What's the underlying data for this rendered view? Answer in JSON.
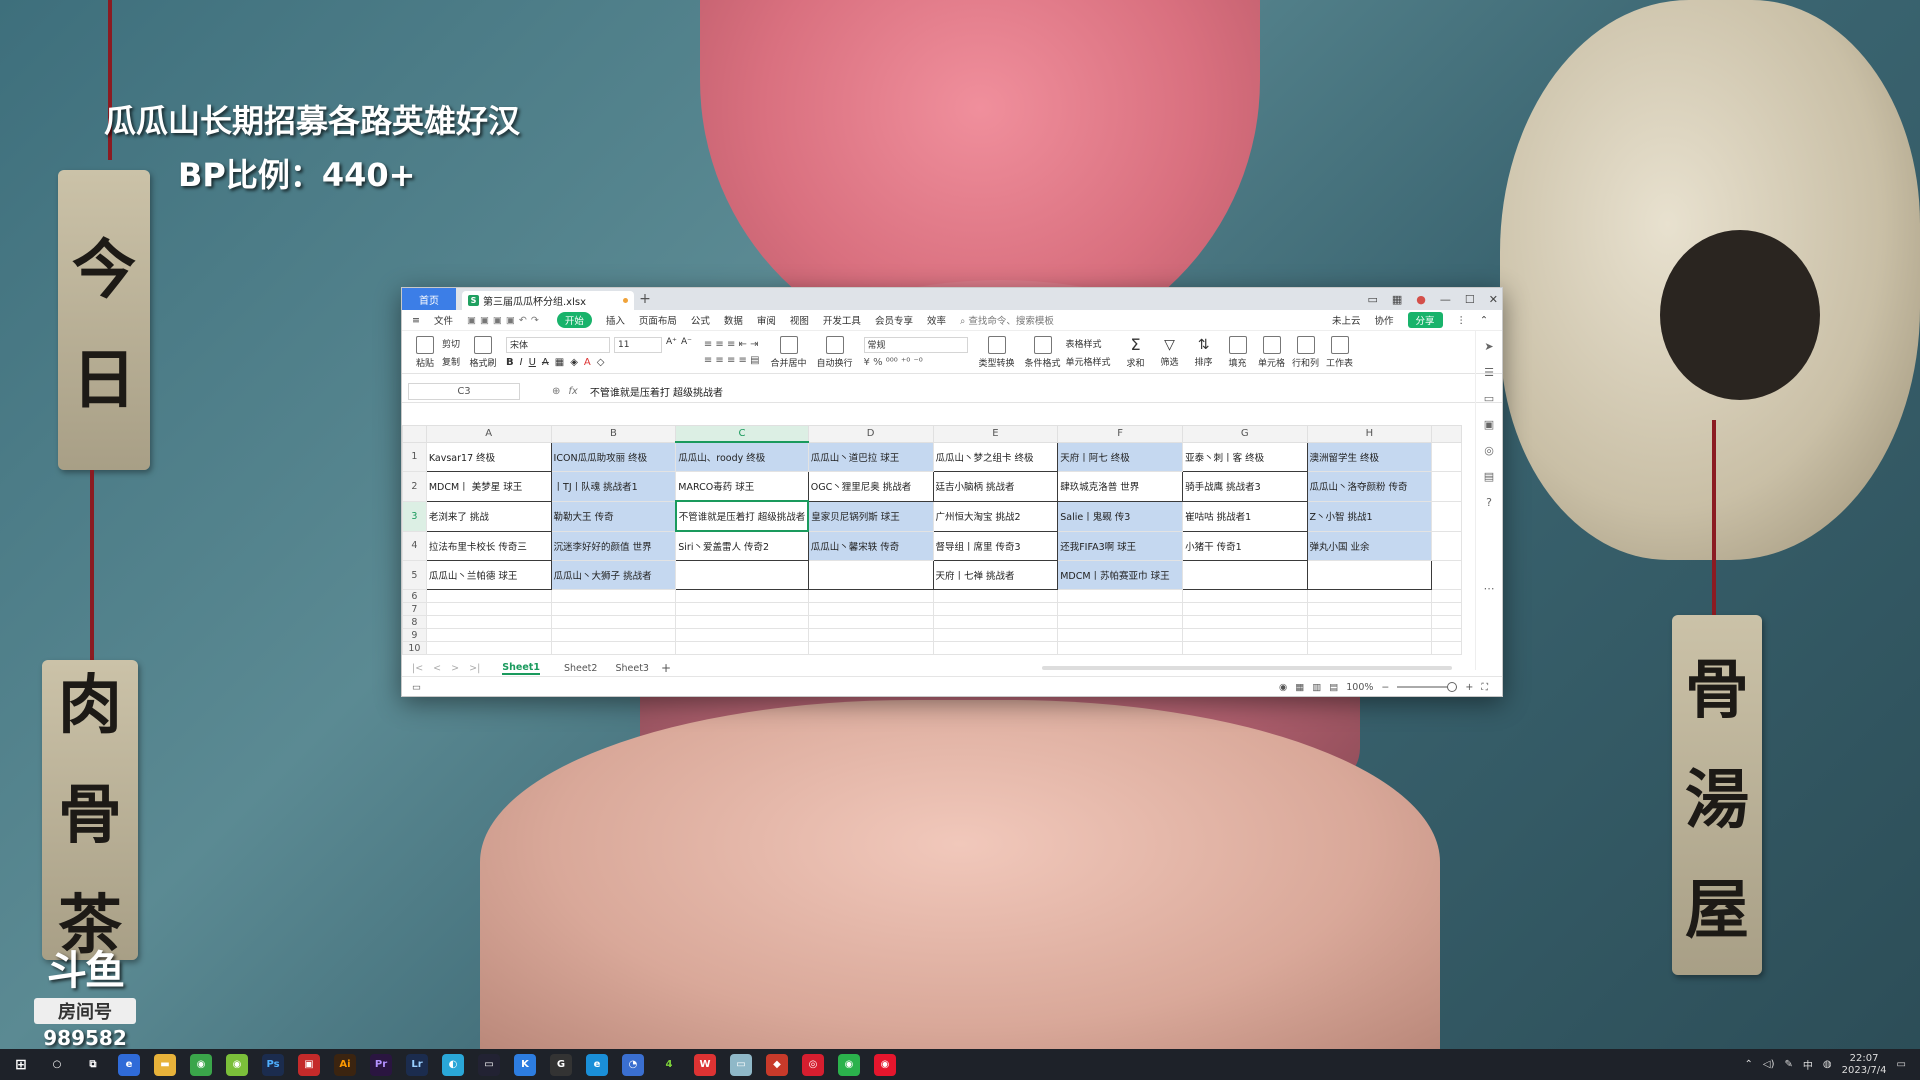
{
  "overlay": {
    "line1": "瓜瓜山长期招募各路英雄好汉",
    "line2": "BP比例：440+",
    "room_label": "房间号",
    "room_number": "989582",
    "brand": "斗鱼"
  },
  "wallpaper_tags": {
    "left_top": [
      "今",
      "日"
    ],
    "left_bottom": [
      "肉",
      "骨",
      "茶"
    ],
    "right": [
      "骨",
      "湯",
      "屋"
    ]
  },
  "app": {
    "home_tab": "首页",
    "file_tab": "第三届瓜瓜杯分组.xlsx",
    "menu": [
      "文件",
      "开始",
      "插入",
      "页面布局",
      "公式",
      "数据",
      "审阅",
      "视图",
      "开发工具",
      "会员专享",
      "效率"
    ],
    "active_menu": "开始",
    "search_placeholder": "查找命令、搜索模板",
    "cloud_label": "未上云",
    "collab_label": "协作",
    "share_label": "分享",
    "ribbon": {
      "paste": "粘贴",
      "cut": "剪切",
      "copy": "复制",
      "format_painter": "格式刷",
      "font_name": "宋体",
      "font_size": "11",
      "merge": "合并居中",
      "wrap": "自动换行",
      "number_format": "常规",
      "type_convert": "类型转换",
      "cond_format": "条件格式",
      "table_style": "表格样式",
      "cell_style": "单元格样式",
      "sum": "求和",
      "filter": "筛选",
      "sort": "排序",
      "fill": "填充",
      "cell": "单元格",
      "rowcol": "行和列",
      "worksheet": "工作表"
    },
    "namebox": "C3",
    "formula": "不管谁就是压着打 超级挑战者",
    "columns": [
      "A",
      "B",
      "C",
      "D",
      "E",
      "F",
      "G",
      "H"
    ],
    "selected_col": "C",
    "rows": [
      [
        "Kavsar17  终极",
        "ICON瓜瓜助攻丽  终极",
        "瓜瓜山、roody  终极",
        "瓜瓜山丶道巴拉  球王",
        "瓜瓜山丶梦之组卡 终极",
        "天府丨阿七  终极",
        "亚泰丶刺丨客  终极",
        "澳洲留学生 终极"
      ],
      [
        "MDCM丨 美梦星 球王",
        "丨TJ丨队魂 挑战者1",
        "MARCO毒药  球王",
        "OGC丶狸里尼奥 挑战者",
        "廷吉小脑柄 挑战者",
        "肆玖城克洛普 世界",
        "骑手战鹰 挑战者3",
        "瓜瓜山丶洛夺颜粉  传奇"
      ],
      [
        "老浏来了  挑战",
        "勒勒大王  传奇",
        "不管谁就是压着打 超级挑战者",
        "皇家贝尼锅列斯  球王",
        "广州恒大淘宝  挑战2",
        "Salie丨鬼觋  传3",
        "崔咕咕 挑战者1",
        "Z丶小智  挑战1"
      ],
      [
        "拉法布里卡校长 传奇三",
        "沉迷李好好的颜值 世界",
        "Siri丶爱盖雷人  传奇2",
        "瓜瓜山丶馨宋轶 传奇",
        "督导组丨席里 传奇3",
        "还我FIFA3啊  球王",
        "小猪干 传奇1",
        "弹丸小国  业余"
      ],
      [
        "瓜瓜山丶兰帕德  球王",
        "瓜瓜山丶大狮子 挑战者",
        "",
        "",
        "天府丨七禅  挑战者",
        "MDCM丨苏帕赛亚巾 球王",
        "",
        ""
      ]
    ],
    "row_numbers": [
      "1",
      "2",
      "3",
      "4",
      "5",
      "6",
      "7",
      "8",
      "9",
      "10"
    ],
    "sheets": [
      "Sheet1",
      "Sheet2",
      "Sheet3"
    ],
    "active_sheet": "Sheet1",
    "zoom": "100%"
  },
  "taskbar": {
    "time": "22:07",
    "date": "2023/7/4",
    "ime": "中"
  },
  "colors": {
    "accent": "#1a9a5d",
    "cell_blue": "#c5d8f0",
    "home_blue": "#3c7ee7"
  }
}
